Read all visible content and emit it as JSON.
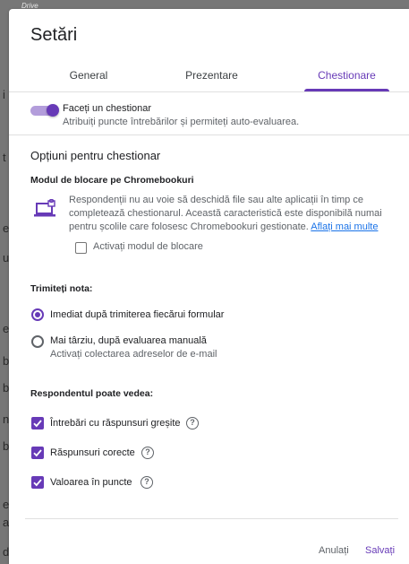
{
  "background": {
    "app_label": "Drive",
    "edge_letters": [
      "i",
      "t",
      "e",
      "u",
      "e",
      "b",
      "b",
      "n",
      "b",
      "e",
      "a",
      "d"
    ]
  },
  "dialog": {
    "title": "Setări",
    "tabs": [
      {
        "label": "General",
        "active": false
      },
      {
        "label": "Prezentare",
        "active": false
      },
      {
        "label": "Chestionare",
        "active": true
      }
    ],
    "quiz_toggle": {
      "on": true,
      "label": "Faceți un chestionar",
      "description": "Atribuiți puncte întrebărilor și permiteți auto-evaluarea."
    },
    "options_title": "Opțiuni pentru chestionar",
    "lock_mode": {
      "heading": "Modul de blocare pe Chromebookuri",
      "description": "Respondenții nu au voie să deschidă file sau alte aplicații în timp ce completează chestionarul. Această caracteristică este disponibilă numai pentru școlile care folosesc Chromebookuri gestionate.",
      "learn_more": "Aflați mai multe",
      "checkbox_label": "Activați modul de blocare",
      "checked": false
    },
    "release_grade": {
      "heading": "Trimiteți nota:",
      "options": [
        {
          "label": "Imediat după trimiterea fiecărui formular",
          "selected": true,
          "note": ""
        },
        {
          "label": "Mai târziu, după evaluarea manuală",
          "selected": false,
          "note": "Activați colectarea adreselor de e-mail"
        }
      ]
    },
    "respondent_can_see": {
      "heading": "Respondentul poate vedea:",
      "items": [
        {
          "label": "Întrebări cu răspunsuri greșite",
          "checked": true,
          "help": "?"
        },
        {
          "label": "Răspunsuri corecte",
          "checked": true,
          "help": "?"
        },
        {
          "label": "Valoarea în puncte",
          "checked": true,
          "help": "?"
        }
      ]
    },
    "footer": {
      "cancel_label": "Anulați",
      "save_label": "Salvați"
    }
  },
  "colors": {
    "accent": "#673ab7",
    "link": "#1a73e8"
  }
}
